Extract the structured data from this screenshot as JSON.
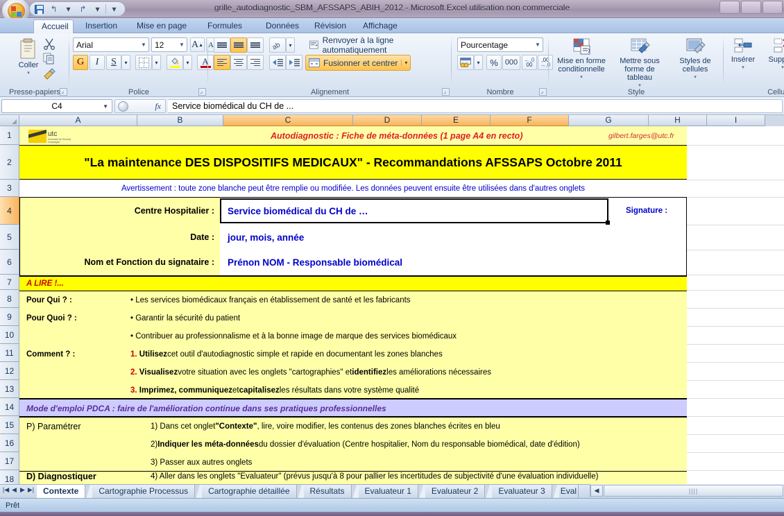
{
  "window": {
    "title": "grille_autodiagnostic_SBM_AFSSAPS_ABIH_2012 - Microsoft Excel utilisation non commerciale"
  },
  "quick_access": {
    "save": "save-icon",
    "undo": "undo-icon",
    "redo": "redo-icon",
    "more": "more-icon"
  },
  "ribbon": {
    "tabs": [
      {
        "label": "Accueil",
        "active": true
      },
      {
        "label": "Insertion",
        "active": false
      },
      {
        "label": "Mise en page",
        "active": false
      },
      {
        "label": "Formules",
        "active": false
      },
      {
        "label": "Données",
        "active": false
      },
      {
        "label": "Révision",
        "active": false
      },
      {
        "label": "Affichage",
        "active": false
      }
    ],
    "groups": {
      "clipboard": {
        "label": "Presse-papiers",
        "paste": "Coller",
        "cut": "cut-icon",
        "copy": "copy-icon",
        "format_painter": "format-painter-icon"
      },
      "font": {
        "label": "Police",
        "font_name": "Arial",
        "font_size": "12",
        "grow": "A",
        "shrink": "A",
        "bold": "G",
        "italic": "I",
        "underline": "S",
        "borders": "borders-icon",
        "fill_color": "fill-color-icon",
        "font_color": "font-color-icon"
      },
      "alignment": {
        "label": "Alignement",
        "wrap_text": "Renvoyer à la ligne automatiquement",
        "merge_center": "Fusionner et centrer",
        "orientation": "orientation-icon",
        "indent_decrease": "decrease-indent-icon",
        "indent_increase": "increase-indent-icon"
      },
      "number": {
        "label": "Nombre",
        "format": "Pourcentage",
        "accounting": "accounting-format-icon",
        "percent": "%",
        "thousands": "000",
        "decrease_decimal": ",00",
        "increase_decimal": ",0"
      },
      "styles": {
        "label": "Style",
        "conditional": "Mise en forme conditionnelle",
        "as_table": "Mettre sous forme de tableau",
        "cell_styles": "Styles de cellules"
      },
      "cells": {
        "label": "Cellul",
        "insert": "Insérer",
        "delete": "Supprim"
      }
    }
  },
  "formula_bar": {
    "name_box": "C4",
    "fx_label": "fx",
    "content": "Service biomédical du CH de ..."
  },
  "grid": {
    "columns": [
      {
        "label": "A",
        "width": 170,
        "selected": false
      },
      {
        "label": "B",
        "width": 124,
        "selected": false
      },
      {
        "label": "C",
        "width": 187,
        "selected": true
      },
      {
        "label": "D",
        "width": 99,
        "selected": true
      },
      {
        "label": "E",
        "width": 99,
        "selected": true
      },
      {
        "label": "F",
        "width": 113,
        "selected": true
      },
      {
        "label": "G",
        "width": 115,
        "selected": false
      },
      {
        "label": "H",
        "width": 84,
        "selected": false
      },
      {
        "label": "I",
        "width": 84,
        "selected": false
      }
    ],
    "rows": [
      {
        "label": "1",
        "height": 27,
        "selected": false
      },
      {
        "label": "2",
        "height": 50,
        "selected": false
      },
      {
        "label": "3",
        "height": 25,
        "selected": false
      },
      {
        "label": "4",
        "height": 40,
        "selected": true
      },
      {
        "label": "5",
        "height": 36,
        "selected": false
      },
      {
        "label": "6",
        "height": 36,
        "selected": false
      },
      {
        "label": "7",
        "height": 22,
        "selected": false
      },
      {
        "label": "8",
        "height": 26,
        "selected": false
      },
      {
        "label": "9",
        "height": 26,
        "selected": false
      },
      {
        "label": "10",
        "height": 26,
        "selected": false
      },
      {
        "label": "11",
        "height": 26,
        "selected": false
      },
      {
        "label": "12",
        "height": 26,
        "selected": false
      },
      {
        "label": "13",
        "height": 26,
        "selected": false
      },
      {
        "label": "14",
        "height": 26,
        "selected": false
      },
      {
        "label": "15",
        "height": 26,
        "selected": false
      },
      {
        "label": "16",
        "height": 26,
        "selected": false
      },
      {
        "label": "17",
        "height": 26,
        "selected": false
      },
      {
        "label": "18",
        "height": 26,
        "selected": false
      }
    ],
    "content": {
      "header_banner": "Autodiagnostic :   Fiche de méta-données (1 page A4 en recto)",
      "header_email": "gilbert.farges@utc.fr",
      "logo": "utc",
      "logo_sub": "Université de Technologie Compiègne",
      "main_title": "\"La maintenance DES DISPOSITIFS MEDICAUX\" - Recommandations AFSSAPS Octobre 2011",
      "warning": "Avertissement : toute zone blanche peut être remplie ou modifiée. Les données peuvent ensuite être utilisées dans d'autres onglets",
      "label_centre": "Centre Hospitalier :",
      "value_centre": "Service biomédical du CH de …",
      "label_signature": "Signature :",
      "label_date": "Date :",
      "value_date": "jour, mois, année",
      "label_signataire": "Nom et Fonction du signataire :",
      "value_signataire": "Prénon NOM - Responsable biomédical",
      "a_lire": "A LIRE !...",
      "pour_qui_label": "Pour Qui ? :",
      "pour_qui_text": "• Les services biomédicaux français en établissement de santé et les fabricants",
      "pour_quoi_label": "Pour Quoi ? :",
      "pour_quoi_text": "• Garantir la sécurité du patient",
      "pour_quoi_text2": "• Contribuer au professionnalisme et à la bonne image de marque  des services biomédicaux",
      "comment_label": "Comment  ? :",
      "comment_1_num": "1.",
      "comment_1_bold": "Utilisez",
      "comment_1_rest": " cet outil d'autodiagnostic simple et rapide en documentant les zones blanches",
      "comment_2_num": "2.",
      "comment_2_bold": "Visualisez",
      "comment_2_mid": " votre situation avec les onglets \"cartographies\" et ",
      "comment_2_bold2": "identifiez",
      "comment_2_rest": " les améliorations nécessaires",
      "comment_3_num": "3.",
      "comment_3_bold": "Imprimez, communiquez",
      "comment_3_mid": " et ",
      "comment_3_bold2": "capitalisez",
      "comment_3_rest": " les résultats dans votre système qualité",
      "pdca_banner": "Mode d'emploi PDCA : faire de l'amélioration continue dans ses pratiques professionnelles",
      "p_label": "P) Paramétrer",
      "p_1_a": "1) Dans cet onglet ",
      "p_1_bold": "\"Contexte\"",
      "p_1_b": ", lire, voire modifier, les contenus des zones blanches écrites en bleu",
      "p_2_a": "2) ",
      "p_2_bold": "Indiquer les méta-données",
      "p_2_b": " du dossier d'évaluation (Centre hospitalier, Nom du responsable biomédical, date d'édition)",
      "p_3": "3) Passer aux autres onglets",
      "d_label": "D) Diagnostiquer",
      "d_4": "4) Aller dans les onglets \"Evaluateur\" (prévus jusqu'à 8 pour pallier les incertitudes de subjectivité d'une évaluation individuelle)"
    }
  },
  "sheet_tabs": [
    {
      "label": "Contexte",
      "active": true
    },
    {
      "label": "Cartographie Processus",
      "active": false
    },
    {
      "label": "Cartographie détaillée",
      "active": false
    },
    {
      "label": "Résultats",
      "active": false
    },
    {
      "label": "Evaluateur 1",
      "active": false
    },
    {
      "label": "Evaluateur 2",
      "active": false
    },
    {
      "label": "Evaluateur 3",
      "active": false
    },
    {
      "label": "Eval",
      "active": false
    }
  ],
  "status_bar": {
    "text": "Prêt"
  },
  "colors": {
    "yellow": "#ffff00",
    "light_yellow": "#ffffa8",
    "lavender": "#ccccff",
    "blue_text": "#0000cc",
    "red_text": "#ff0000",
    "purple_text": "#5b2d9b"
  }
}
